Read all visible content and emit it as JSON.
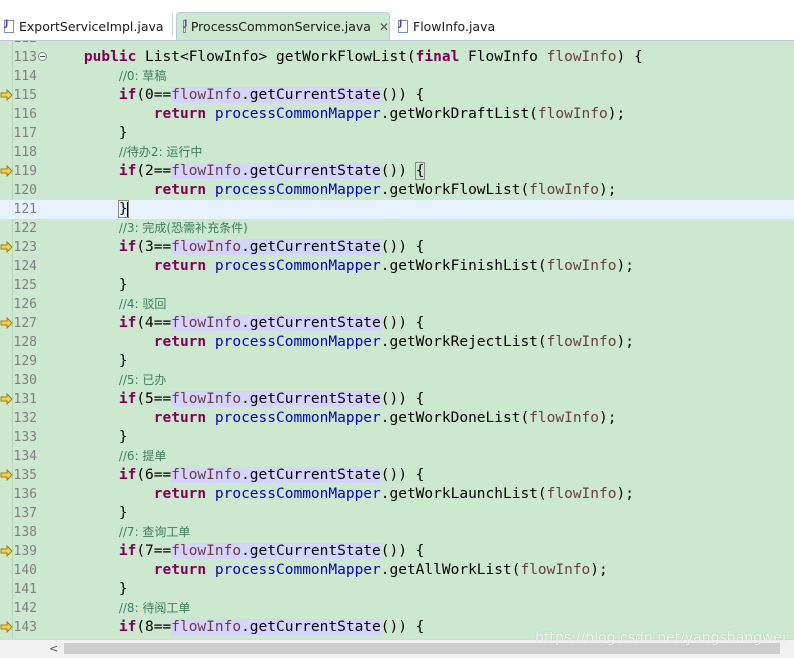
{
  "tabs": [
    {
      "label": "ExportServiceImpl.java",
      "active": false
    },
    {
      "label": "ProcessCommonService.java",
      "active": true
    },
    {
      "label": "FlowInfo.java",
      "active": false
    }
  ],
  "tab_close_glyph": "✕",
  "partial_top": "112",
  "lines": [
    {
      "n": "113",
      "fold": true,
      "seg": [
        [
          "    ",
          ""
        ],
        [
          "public",
          "kw"
        ],
        [
          " List<FlowInfo> getWorkFlowList(",
          ""
        ],
        [
          "final",
          "kw"
        ],
        [
          " FlowInfo ",
          ""
        ],
        [
          "flowInfo",
          "pm"
        ],
        [
          ") {",
          ""
        ]
      ]
    },
    {
      "n": "114",
      "seg": [
        [
          "        ",
          ""
        ],
        [
          "//0: 草稿",
          "cm"
        ]
      ]
    },
    {
      "n": "115",
      "mark": true,
      "seg": [
        [
          "        ",
          ""
        ],
        [
          "if",
          "kw"
        ],
        [
          "(0==",
          ""
        ],
        [
          "flowInfo",
          "pm hl"
        ],
        [
          ".getCurrentState",
          "hl"
        ],
        [
          "()) {",
          ""
        ]
      ]
    },
    {
      "n": "116",
      "seg": [
        [
          "            ",
          ""
        ],
        [
          "return",
          "kw"
        ],
        [
          " ",
          ""
        ],
        [
          "processCommonMapper",
          "fv"
        ],
        [
          ".getWorkDraftList(",
          ""
        ],
        [
          "flowInfo",
          "pm"
        ],
        [
          ");",
          ""
        ]
      ]
    },
    {
      "n": "117",
      "seg": [
        [
          "        }",
          ""
        ]
      ]
    },
    {
      "n": "118",
      "seg": [
        [
          "        ",
          ""
        ],
        [
          "//待办2: 运行中",
          "cm"
        ]
      ]
    },
    {
      "n": "119",
      "mark": true,
      "seg": [
        [
          "        ",
          ""
        ],
        [
          "if",
          "kw"
        ],
        [
          "(2==",
          ""
        ],
        [
          "flowInfo",
          "pm hl"
        ],
        [
          ".getCurrentState",
          "hl"
        ],
        [
          "()) ",
          ""
        ],
        [
          "{",
          "bracket"
        ]
      ]
    },
    {
      "n": "120",
      "seg": [
        [
          "            ",
          ""
        ],
        [
          "return",
          "kw"
        ],
        [
          " ",
          ""
        ],
        [
          "processCommonMapper",
          "fv"
        ],
        [
          ".getWorkFlowList(",
          ""
        ],
        [
          "flowInfo",
          "pm"
        ],
        [
          ");",
          ""
        ]
      ]
    },
    {
      "n": "121",
      "cur": true,
      "caret": true,
      "seg": [
        [
          "        ",
          ""
        ],
        [
          "}",
          "bracket"
        ]
      ]
    },
    {
      "n": "122",
      "seg": [
        [
          "        ",
          ""
        ],
        [
          "//3: 完成(恐需补充条件)",
          "cm"
        ]
      ]
    },
    {
      "n": "123",
      "mark": true,
      "seg": [
        [
          "        ",
          ""
        ],
        [
          "if",
          "kw"
        ],
        [
          "(3==",
          ""
        ],
        [
          "flowInfo",
          "pm hl"
        ],
        [
          ".getCurrentState",
          "hl"
        ],
        [
          "()) {",
          ""
        ]
      ]
    },
    {
      "n": "124",
      "seg": [
        [
          "            ",
          ""
        ],
        [
          "return",
          "kw"
        ],
        [
          " ",
          ""
        ],
        [
          "processCommonMapper",
          "fv"
        ],
        [
          ".getWorkFinishList(",
          ""
        ],
        [
          "flowInfo",
          "pm"
        ],
        [
          ");",
          ""
        ]
      ]
    },
    {
      "n": "125",
      "seg": [
        [
          "        }",
          ""
        ]
      ]
    },
    {
      "n": "126",
      "seg": [
        [
          "        ",
          ""
        ],
        [
          "//4: 驳回",
          "cm"
        ]
      ]
    },
    {
      "n": "127",
      "mark": true,
      "seg": [
        [
          "        ",
          ""
        ],
        [
          "if",
          "kw"
        ],
        [
          "(4==",
          ""
        ],
        [
          "flowInfo",
          "pm hl"
        ],
        [
          ".getCurrentState",
          "hl"
        ],
        [
          "()) {",
          ""
        ]
      ]
    },
    {
      "n": "128",
      "seg": [
        [
          "            ",
          ""
        ],
        [
          "return",
          "kw"
        ],
        [
          " ",
          ""
        ],
        [
          "processCommonMapper",
          "fv"
        ],
        [
          ".getWorkRejectList(",
          ""
        ],
        [
          "flowInfo",
          "pm"
        ],
        [
          ");",
          ""
        ]
      ]
    },
    {
      "n": "129",
      "seg": [
        [
          "        }",
          ""
        ]
      ]
    },
    {
      "n": "130",
      "seg": [
        [
          "        ",
          ""
        ],
        [
          "//5: 已办",
          "cm"
        ]
      ]
    },
    {
      "n": "131",
      "mark": true,
      "seg": [
        [
          "        ",
          ""
        ],
        [
          "if",
          "kw"
        ],
        [
          "(5==",
          ""
        ],
        [
          "flowInfo",
          "pm hl"
        ],
        [
          ".getCurrentState",
          "hl"
        ],
        [
          "()) {",
          ""
        ]
      ]
    },
    {
      "n": "132",
      "seg": [
        [
          "            ",
          ""
        ],
        [
          "return",
          "kw"
        ],
        [
          " ",
          ""
        ],
        [
          "processCommonMapper",
          "fv"
        ],
        [
          ".getWorkDoneList(",
          ""
        ],
        [
          "flowInfo",
          "pm"
        ],
        [
          ");",
          ""
        ]
      ]
    },
    {
      "n": "133",
      "seg": [
        [
          "        }",
          ""
        ]
      ]
    },
    {
      "n": "134",
      "seg": [
        [
          "        ",
          ""
        ],
        [
          "//6: 提单",
          "cm"
        ]
      ]
    },
    {
      "n": "135",
      "mark": true,
      "seg": [
        [
          "        ",
          ""
        ],
        [
          "if",
          "kw"
        ],
        [
          "(6==",
          ""
        ],
        [
          "flowInfo",
          "pm hl"
        ],
        [
          ".getCurrentState",
          "hl"
        ],
        [
          "()) {",
          ""
        ]
      ]
    },
    {
      "n": "136",
      "seg": [
        [
          "            ",
          ""
        ],
        [
          "return",
          "kw"
        ],
        [
          " ",
          ""
        ],
        [
          "processCommonMapper",
          "fv"
        ],
        [
          ".getWorkLaunchList(",
          ""
        ],
        [
          "flowInfo",
          "pm"
        ],
        [
          ");",
          ""
        ]
      ]
    },
    {
      "n": "137",
      "seg": [
        [
          "        }",
          ""
        ]
      ]
    },
    {
      "n": "138",
      "seg": [
        [
          "        ",
          ""
        ],
        [
          "//7: 查询工单",
          "cm"
        ]
      ]
    },
    {
      "n": "139",
      "mark": true,
      "seg": [
        [
          "        ",
          ""
        ],
        [
          "if",
          "kw"
        ],
        [
          "(7==",
          ""
        ],
        [
          "flowInfo",
          "pm hl"
        ],
        [
          ".getCurrentState",
          "hl"
        ],
        [
          "()) {",
          ""
        ]
      ]
    },
    {
      "n": "140",
      "seg": [
        [
          "            ",
          ""
        ],
        [
          "return",
          "kw"
        ],
        [
          " ",
          ""
        ],
        [
          "processCommonMapper",
          "fv"
        ],
        [
          ".getAllWorkList(",
          ""
        ],
        [
          "flowInfo",
          "pm"
        ],
        [
          ");",
          ""
        ]
      ]
    },
    {
      "n": "141",
      "seg": [
        [
          "        }",
          ""
        ]
      ]
    },
    {
      "n": "142",
      "seg": [
        [
          "        ",
          ""
        ],
        [
          "//8: 待阅工单",
          "cm"
        ]
      ]
    },
    {
      "n": "143",
      "mark": true,
      "seg": [
        [
          "        ",
          ""
        ],
        [
          "if",
          "kw"
        ],
        [
          "(8==",
          ""
        ],
        [
          "flowInfo",
          "pm hl"
        ],
        [
          ".getCurrentState",
          "hl"
        ],
        [
          "()) {",
          ""
        ]
      ]
    }
  ],
  "scroll_left_glyph": "<",
  "watermark": "https://blog.csdn.net/yangshangwei",
  "colors": {
    "editor_bg": "#cce8cf",
    "keyword": "#7f0055",
    "comment": "#3f7f5f",
    "field": "#0000c0",
    "param": "#6a3e3e",
    "occurrence_highlight": "#d4d4ff",
    "current_line": "#e8f2fe"
  },
  "icons": {
    "tab_file": "java-file-icon",
    "gutter_marker": "override-arrow-icon",
    "fold": "collapse-icon"
  }
}
